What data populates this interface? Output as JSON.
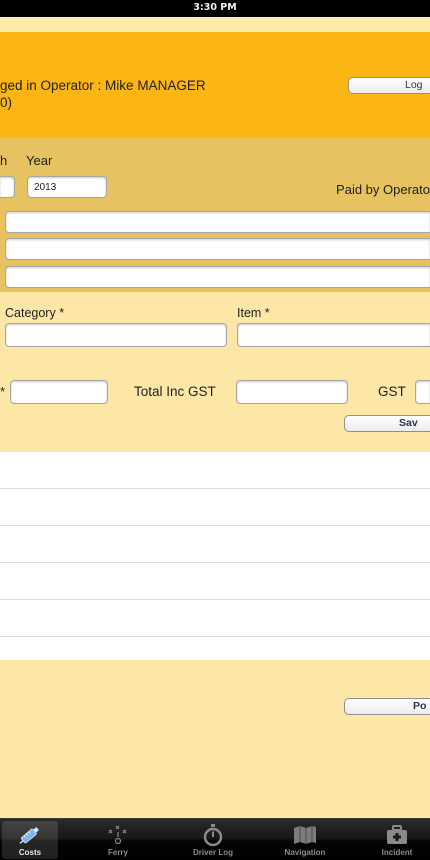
{
  "status_bar": {
    "time": "3:30 PM"
  },
  "colors": {
    "status_bar": "#000000",
    "top_strip": "#fde9a8",
    "header": "#fcb614",
    "form_top": "#e6c261",
    "form_bottom": "#fde7a7",
    "list": "#ffffff",
    "tab_bar": "#0d0d0d",
    "selected_tab_icon": "#7fb4e6"
  },
  "header": {
    "logged_in_text": "ged in Operator : Mike MANAGER",
    "logged_in_subtext": "0)",
    "logout_button": "Log"
  },
  "form": {
    "month_label": "h",
    "year_label": "Year",
    "year_value": "2013",
    "paid_by_label": "Paid by Operato",
    "category_label": "Category *",
    "item_label": "Item *",
    "amount_label": "*",
    "total_label": "Total Inc GST",
    "gst_label": "GST",
    "save_button": "Sav"
  },
  "footer": {
    "post_button": "Po"
  },
  "tab_bar": {
    "tabs": [
      {
        "label": "Costs",
        "icon": "costs-icon",
        "selected": true
      },
      {
        "label": "Ferry",
        "icon": "ferry-icon",
        "selected": false
      },
      {
        "label": "Driver Log",
        "icon": "driver-log-icon",
        "selected": false
      },
      {
        "label": "Navigation",
        "icon": "navigation-icon",
        "selected": false
      },
      {
        "label": "Incident",
        "icon": "incident-icon",
        "selected": false
      }
    ]
  }
}
